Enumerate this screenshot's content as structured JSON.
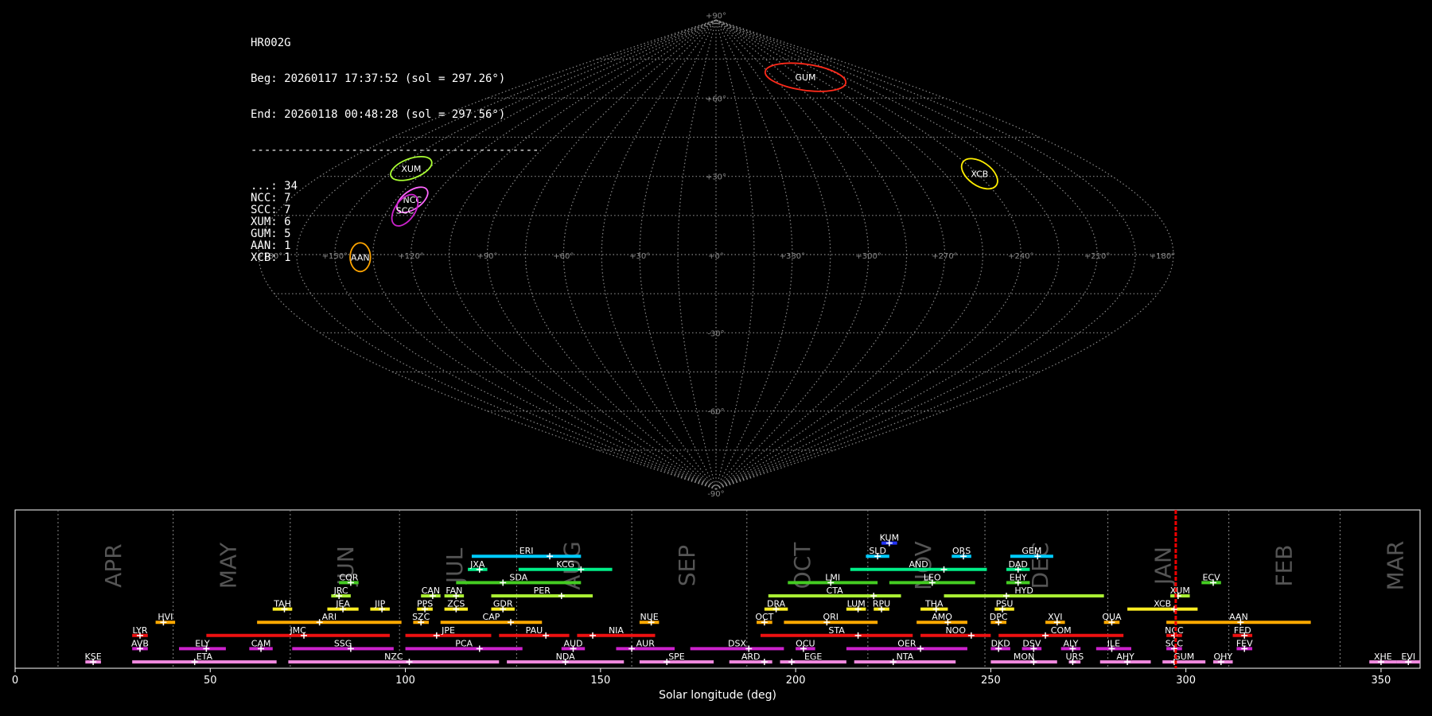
{
  "info": {
    "station": "HR002G",
    "begin": "Beg: 20260117 17:37:52 (sol = 297.26°)",
    "end": "End: 20260118 00:48:28 (sol = 297.56°)",
    "separator": "-------------------------------------------",
    "counts": [
      {
        "label": "...",
        "value": 34
      },
      {
        "label": "NCC",
        "value": 7
      },
      {
        "label": "SCC",
        "value": 7
      },
      {
        "label": "XUM",
        "value": 6
      },
      {
        "label": "GUM",
        "value": 5
      },
      {
        "label": "AAN",
        "value": 1
      },
      {
        "label": "XCB",
        "value": 1
      }
    ]
  },
  "sky_map": {
    "projection": "sinusoidal",
    "lon_center": 0,
    "lon_ticks": [
      180,
      150,
      120,
      90,
      60,
      30,
      0,
      330,
      300,
      270,
      240,
      210,
      180
    ],
    "lon_tick_labels": [
      "+180°",
      "+150°",
      "+120°",
      "+90°",
      "+60°",
      "+30°",
      "+0°",
      "+330°",
      "+300°",
      "+270°",
      "+240°",
      "+210°",
      "+180°"
    ],
    "lat_ticks": [
      90,
      60,
      30,
      -30,
      -60,
      -90
    ],
    "lat_tick_labels": [
      "+90°",
      "+60°",
      "+30°",
      "-30°",
      "-60°",
      "-90°"
    ],
    "grid": true,
    "radiants": [
      {
        "name": "GUM",
        "lon": 266,
        "lat": 68,
        "color": "#ff2a1a",
        "ew": 16,
        "eh": 5,
        "ang": 8
      },
      {
        "name": "XCB",
        "lon": 239,
        "lat": 31,
        "color": "#ffee00",
        "ew": 8,
        "eh": 4.5,
        "ang": 35
      },
      {
        "name": "XUM",
        "lon": 143,
        "lat": 33,
        "color": "#aaff33",
        "ew": 8.5,
        "eh": 3.8,
        "ang": -20
      },
      {
        "name": "NCC",
        "lon": 128,
        "lat": 21,
        "color": "#ff66ff",
        "ew": 7,
        "eh": 3.5,
        "ang": -35
      },
      {
        "name": "SCC",
        "lon": 128,
        "lat": 17,
        "color": "#cc22cc",
        "ew": 7,
        "eh": 3.8,
        "ang": -55
      },
      {
        "name": "AAN",
        "lon": 140,
        "lat": -1,
        "color": "#ffa500",
        "ew": 4,
        "eh": 5.5,
        "ang": 0
      }
    ]
  },
  "chart_data": {
    "type": "timeline",
    "xlabel": "Solar longitude (deg)",
    "xlim": [
      0,
      360
    ],
    "xticks": [
      0,
      50,
      100,
      150,
      200,
      250,
      300,
      350
    ],
    "current_sol": 297.4,
    "months": [
      {
        "name": "APR",
        "start": 11.0
      },
      {
        "name": "MAY",
        "start": 40.5
      },
      {
        "name": "JUN",
        "start": 70.5
      },
      {
        "name": "JUL",
        "start": 98.5
      },
      {
        "name": "AUG",
        "start": 128.5
      },
      {
        "name": "SEP",
        "start": 158.0
      },
      {
        "name": "OCT",
        "start": 187.5
      },
      {
        "name": "NOV",
        "start": 218.5
      },
      {
        "name": "DEC",
        "start": 248.5
      },
      {
        "name": "JAN",
        "start": 280.0
      },
      {
        "name": "FEB",
        "start": 311.0
      },
      {
        "name": "MAR",
        "start": 339.5
      }
    ],
    "showers": [
      {
        "code": "KUM",
        "start": 222,
        "end": 226,
        "peak": 224,
        "row": 9,
        "color": "#2233ff"
      },
      {
        "code": "ERI",
        "start": 117,
        "end": 145,
        "peak": 137,
        "row": 8,
        "color": "#00ccff"
      },
      {
        "code": "SLD",
        "start": 218,
        "end": 224,
        "peak": 221,
        "row": 8,
        "color": "#00ccff"
      },
      {
        "code": "ORS",
        "start": 240,
        "end": 245,
        "peak": 243,
        "row": 8,
        "color": "#00ccff"
      },
      {
        "code": "GEM",
        "start": 255,
        "end": 266,
        "peak": 262,
        "row": 8,
        "color": "#00ccff"
      },
      {
        "code": "JXA",
        "start": 116,
        "end": 121,
        "peak": 119,
        "row": 7,
        "color": "#00ee88"
      },
      {
        "code": "KCG",
        "start": 129,
        "end": 153,
        "peak": 145,
        "row": 7,
        "color": "#00ee88"
      },
      {
        "code": "AND",
        "start": 214,
        "end": 249,
        "peak": 238,
        "row": 7,
        "color": "#00ee88"
      },
      {
        "code": "DAD",
        "start": 254,
        "end": 260,
        "peak": 257,
        "row": 7,
        "color": "#00ee88"
      },
      {
        "code": "COR",
        "start": 83,
        "end": 88,
        "peak": 86,
        "row": 6,
        "color": "#44cc22"
      },
      {
        "code": "SDA",
        "start": 113,
        "end": 145,
        "peak": 125,
        "row": 6,
        "color": "#44cc22"
      },
      {
        "code": "LMI",
        "start": 198,
        "end": 221,
        "peak": 209,
        "row": 6,
        "color": "#44cc22"
      },
      {
        "code": "LEO",
        "start": 224,
        "end": 246,
        "peak": 235,
        "row": 6,
        "color": "#44cc22"
      },
      {
        "code": "EHY",
        "start": 254,
        "end": 260,
        "peak": 257,
        "row": 6,
        "color": "#44cc22"
      },
      {
        "code": "ECV",
        "start": 304,
        "end": 309,
        "peak": 307,
        "row": 6,
        "color": "#44cc22"
      },
      {
        "code": "JRC",
        "start": 81,
        "end": 86,
        "peak": 83,
        "row": 5,
        "color": "#aaee33"
      },
      {
        "code": "CAN",
        "start": 104,
        "end": 109,
        "peak": 107,
        "row": 5,
        "color": "#aaee33"
      },
      {
        "code": "FAN",
        "start": 110,
        "end": 115,
        "peak": 113,
        "row": 5,
        "color": "#aaee33"
      },
      {
        "code": "PER",
        "start": 122,
        "end": 148,
        "peak": 140,
        "row": 5,
        "color": "#aaee33"
      },
      {
        "code": "CTA",
        "start": 193,
        "end": 227,
        "peak": 220,
        "row": 5,
        "color": "#aaee33"
      },
      {
        "code": "HYD",
        "start": 238,
        "end": 279,
        "peak": 254,
        "row": 5,
        "color": "#aaee33"
      },
      {
        "code": "XUM",
        "start": 296,
        "end": 301,
        "peak": 298,
        "row": 5,
        "color": "#aaee33"
      },
      {
        "code": "TAH",
        "start": 66,
        "end": 71,
        "peak": 69,
        "row": 4,
        "color": "#ffee22"
      },
      {
        "code": "JEA",
        "start": 80,
        "end": 88,
        "peak": 84,
        "row": 4,
        "color": "#ffee22"
      },
      {
        "code": "JIP",
        "start": 91,
        "end": 96,
        "peak": 94,
        "row": 4,
        "color": "#ffee22"
      },
      {
        "code": "PPS",
        "start": 103,
        "end": 107,
        "peak": 105,
        "row": 4,
        "color": "#ffee22"
      },
      {
        "code": "ZCS",
        "start": 110,
        "end": 116,
        "peak": 113,
        "row": 4,
        "color": "#ffee22"
      },
      {
        "code": "GDR",
        "start": 122,
        "end": 128,
        "peak": 125,
        "row": 4,
        "color": "#ffee22"
      },
      {
        "code": "DRA",
        "start": 192,
        "end": 198,
        "peak": 195,
        "row": 4,
        "color": "#ffee22"
      },
      {
        "code": "LUM",
        "start": 213,
        "end": 218,
        "peak": 216,
        "row": 4,
        "color": "#ffee22"
      },
      {
        "code": "RPU",
        "start": 220,
        "end": 224,
        "peak": 222,
        "row": 4,
        "color": "#ffee22"
      },
      {
        "code": "THA",
        "start": 232,
        "end": 239,
        "peak": 236,
        "row": 4,
        "color": "#ffee22"
      },
      {
        "code": "PSU",
        "start": 251,
        "end": 256,
        "peak": 253,
        "row": 4,
        "color": "#ffee22"
      },
      {
        "code": "XCB",
        "start": 285,
        "end": 303,
        "peak": 297,
        "row": 4,
        "color": "#ffee22"
      },
      {
        "code": "HVI",
        "start": 36,
        "end": 41,
        "peak": 38,
        "row": 3,
        "color": "#ffaa00"
      },
      {
        "code": "ARI",
        "start": 62,
        "end": 99,
        "peak": 78,
        "row": 3,
        "color": "#ffaa00"
      },
      {
        "code": "SZC",
        "start": 102,
        "end": 106,
        "peak": 104,
        "row": 3,
        "color": "#ffaa00"
      },
      {
        "code": "CAP",
        "start": 109,
        "end": 135,
        "peak": 127,
        "row": 3,
        "color": "#ffaa00"
      },
      {
        "code": "NUE",
        "start": 160,
        "end": 165,
        "peak": 163,
        "row": 3,
        "color": "#ffaa00"
      },
      {
        "code": "OCT",
        "start": 190,
        "end": 194,
        "peak": 192,
        "row": 3,
        "color": "#ffaa00"
      },
      {
        "code": "ORI",
        "start": 197,
        "end": 221,
        "peak": 208,
        "row": 3,
        "color": "#ffaa00"
      },
      {
        "code": "AMO",
        "start": 231,
        "end": 244,
        "peak": 239,
        "row": 3,
        "color": "#ffaa00"
      },
      {
        "code": "DPC",
        "start": 250,
        "end": 254,
        "peak": 252,
        "row": 3,
        "color": "#ffaa00"
      },
      {
        "code": "XVI",
        "start": 264,
        "end": 269,
        "peak": 267,
        "row": 3,
        "color": "#ffaa00"
      },
      {
        "code": "QUA",
        "start": 279,
        "end": 283,
        "peak": 281,
        "row": 3,
        "color": "#ffaa00"
      },
      {
        "code": "AAN",
        "start": 295,
        "end": 332,
        "peak": 314,
        "row": 3,
        "color": "#ffaa00"
      },
      {
        "code": "LYR",
        "start": 30,
        "end": 34,
        "peak": 32,
        "row": 2,
        "color": "#ee1111"
      },
      {
        "code": "JMC",
        "start": 49,
        "end": 96,
        "peak": 74,
        "row": 2,
        "color": "#ee1111"
      },
      {
        "code": "JPE",
        "start": 100,
        "end": 122,
        "peak": 108,
        "row": 2,
        "color": "#ee1111"
      },
      {
        "code": "PAU",
        "start": 124,
        "end": 142,
        "peak": 136,
        "row": 2,
        "color": "#ee1111"
      },
      {
        "code": "NIA",
        "start": 144,
        "end": 164,
        "peak": 148,
        "row": 2,
        "color": "#ee1111"
      },
      {
        "code": "STA",
        "start": 191,
        "end": 230,
        "peak": 216,
        "row": 2,
        "color": "#ee1111"
      },
      {
        "code": "NOO",
        "start": 232,
        "end": 250,
        "peak": 245,
        "row": 2,
        "color": "#ee1111"
      },
      {
        "code": "COM",
        "start": 252,
        "end": 284,
        "peak": 264,
        "row": 2,
        "color": "#ee1111"
      },
      {
        "code": "NCC",
        "start": 295,
        "end": 299,
        "peak": 297,
        "row": 2,
        "color": "#ee1111"
      },
      {
        "code": "FED",
        "start": 312,
        "end": 317,
        "peak": 315,
        "row": 2,
        "color": "#ee1111"
      },
      {
        "code": "AVB",
        "start": 30,
        "end": 34,
        "peak": 32,
        "row": 1,
        "color": "#cc22cc"
      },
      {
        "code": "ELY",
        "start": 42,
        "end": 54,
        "peak": 49,
        "row": 1,
        "color": "#cc22cc"
      },
      {
        "code": "CAM",
        "start": 60,
        "end": 66,
        "peak": 63,
        "row": 1,
        "color": "#cc22cc"
      },
      {
        "code": "SSG",
        "start": 71,
        "end": 97,
        "peak": 86,
        "row": 1,
        "color": "#cc22cc"
      },
      {
        "code": "PCA",
        "start": 100,
        "end": 130,
        "peak": 119,
        "row": 1,
        "color": "#cc22cc"
      },
      {
        "code": "AUD",
        "start": 140,
        "end": 146,
        "peak": 143,
        "row": 1,
        "color": "#cc22cc"
      },
      {
        "code": "AUR",
        "start": 154,
        "end": 169,
        "peak": 158,
        "row": 1,
        "color": "#cc22cc"
      },
      {
        "code": "DSX",
        "start": 173,
        "end": 197,
        "peak": 188,
        "row": 1,
        "color": "#cc22cc"
      },
      {
        "code": "OCU",
        "start": 200,
        "end": 205,
        "peak": 202,
        "row": 1,
        "color": "#cc22cc"
      },
      {
        "code": "OER",
        "start": 213,
        "end": 244,
        "peak": 232,
        "row": 1,
        "color": "#cc22cc"
      },
      {
        "code": "DKD",
        "start": 250,
        "end": 255,
        "peak": 252,
        "row": 1,
        "color": "#cc22cc"
      },
      {
        "code": "DSV",
        "start": 258,
        "end": 263,
        "peak": 261,
        "row": 1,
        "color": "#cc22cc"
      },
      {
        "code": "ALY",
        "start": 268,
        "end": 273,
        "peak": 271,
        "row": 1,
        "color": "#cc22cc"
      },
      {
        "code": "ILE",
        "start": 277,
        "end": 286,
        "peak": 281,
        "row": 1,
        "color": "#cc22cc"
      },
      {
        "code": "SCC",
        "start": 295,
        "end": 299,
        "peak": 297,
        "row": 1,
        "color": "#cc22cc"
      },
      {
        "code": "FEV",
        "start": 313,
        "end": 317,
        "peak": 315,
        "row": 1,
        "color": "#cc22cc"
      },
      {
        "code": "KSE",
        "start": 18,
        "end": 22,
        "peak": 20,
        "row": 0,
        "color": "#ee88dd"
      },
      {
        "code": "ETA",
        "start": 30,
        "end": 67,
        "peak": 46,
        "row": 0,
        "color": "#ee88dd"
      },
      {
        "code": "NZC",
        "start": 70,
        "end": 124,
        "peak": 101,
        "row": 0,
        "color": "#ee88dd"
      },
      {
        "code": "NDA",
        "start": 126,
        "end": 156,
        "peak": 141,
        "row": 0,
        "color": "#ee88dd"
      },
      {
        "code": "SPE",
        "start": 160,
        "end": 179,
        "peak": 167,
        "row": 0,
        "color": "#ee88dd"
      },
      {
        "code": "ARD",
        "start": 183,
        "end": 194,
        "peak": 192,
        "row": 0,
        "color": "#ee88dd"
      },
      {
        "code": "EGE",
        "start": 196,
        "end": 213,
        "peak": 199,
        "row": 0,
        "color": "#ee88dd"
      },
      {
        "code": "NTA",
        "start": 215,
        "end": 241,
        "peak": 225,
        "row": 0,
        "color": "#ee88dd"
      },
      {
        "code": "MON",
        "start": 250,
        "end": 267,
        "peak": 261,
        "row": 0,
        "color": "#ee88dd"
      },
      {
        "code": "URS",
        "start": 270,
        "end": 273,
        "peak": 271,
        "row": 0,
        "color": "#ee88dd"
      },
      {
        "code": "AHY",
        "start": 278,
        "end": 291,
        "peak": 285,
        "row": 0,
        "color": "#ee88dd"
      },
      {
        "code": "GUM",
        "start": 294,
        "end": 305,
        "peak": 297,
        "row": 0,
        "color": "#ee88dd"
      },
      {
        "code": "OHY",
        "start": 307,
        "end": 312,
        "peak": 309,
        "row": 0,
        "color": "#ee88dd"
      },
      {
        "code": "XHE",
        "start": 347,
        "end": 354,
        "peak": 350,
        "row": 0,
        "color": "#ee88dd"
      },
      {
        "code": "EVI",
        "start": 354,
        "end": 360,
        "peak": 357,
        "row": 0,
        "color": "#ee88dd"
      }
    ]
  }
}
